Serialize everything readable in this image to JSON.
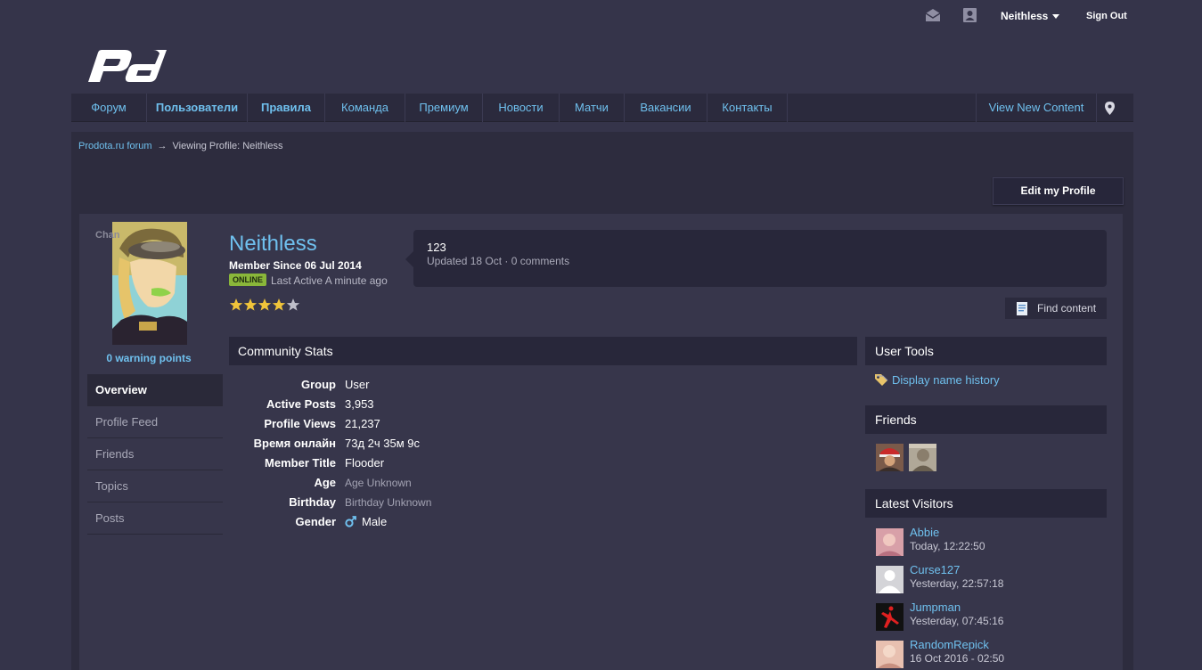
{
  "topbar": {
    "username": "Neithless",
    "signout_label": "Sign Out",
    "icons": [
      "mail-icon",
      "user-card-icon"
    ]
  },
  "brand": {
    "logo_text": "pd"
  },
  "nav": {
    "items": [
      {
        "label": "Форум",
        "bold": false
      },
      {
        "label": "Пользователи",
        "bold": true
      },
      {
        "label": "Правила",
        "bold": true
      },
      {
        "label": "Команда",
        "bold": false
      },
      {
        "label": "Премиум",
        "bold": false
      },
      {
        "label": "Новости",
        "bold": false
      },
      {
        "label": "Матчи",
        "bold": false
      },
      {
        "label": "Вакансии",
        "bold": false
      },
      {
        "label": "Контакты",
        "bold": false
      }
    ],
    "view_new_content": "View New Content"
  },
  "breadcrumb": {
    "root": "Prodota.ru forum",
    "arrow": "→",
    "current": "Viewing Profile: Neithless"
  },
  "edit_profile_label": "Edit my Profile",
  "profile": {
    "avatar_overlay": "Chan",
    "warning_points": "0 warning points",
    "name": "Neithless",
    "member_since": "Member Since 06 Jul 2014",
    "online_badge": "ONLINE",
    "last_active": "Last Active A minute ago",
    "rating": 4,
    "rating_max": 5
  },
  "sidemenu": {
    "items": [
      "Overview",
      "Profile Feed",
      "Friends",
      "Topics",
      "Posts"
    ],
    "active": "Overview"
  },
  "status": {
    "text": "123",
    "meta": "Updated 18 Oct · 0 comments"
  },
  "find_content_label": "Find content",
  "community_stats": {
    "title": "Community Stats",
    "rows": [
      {
        "label": "Group",
        "value": "User"
      },
      {
        "label": "Active Posts",
        "value": "3,953"
      },
      {
        "label": "Profile Views",
        "value": "21,237"
      },
      {
        "label": "Время онлайн",
        "value": "73д 2ч 35м 9с"
      },
      {
        "label": "Member Title",
        "value": "Flooder"
      },
      {
        "label": "Age",
        "value": "Age Unknown"
      },
      {
        "label": "Birthday",
        "value": "Birthday Unknown"
      },
      {
        "label": "Gender",
        "value": "Male"
      }
    ]
  },
  "user_tools": {
    "title": "User Tools",
    "link": "Display name history"
  },
  "friends": {
    "title": "Friends"
  },
  "latest_visitors": {
    "title": "Latest Visitors",
    "items": [
      {
        "name": "Abbie",
        "time": "Today, 12:22:50"
      },
      {
        "name": "Curse127",
        "time": "Yesterday, 22:57:18"
      },
      {
        "name": "Jumpman",
        "time": "Yesterday, 07:45:16"
      },
      {
        "name": "RandomRepick",
        "time": "16 Oct 2016 - 02:50"
      }
    ]
  },
  "colors": {
    "background": "#35344a",
    "panel": "#37364b",
    "header": "#28273a",
    "link": "#6fc0ee",
    "online": "#8ab73a",
    "star": "#f0c43a"
  }
}
